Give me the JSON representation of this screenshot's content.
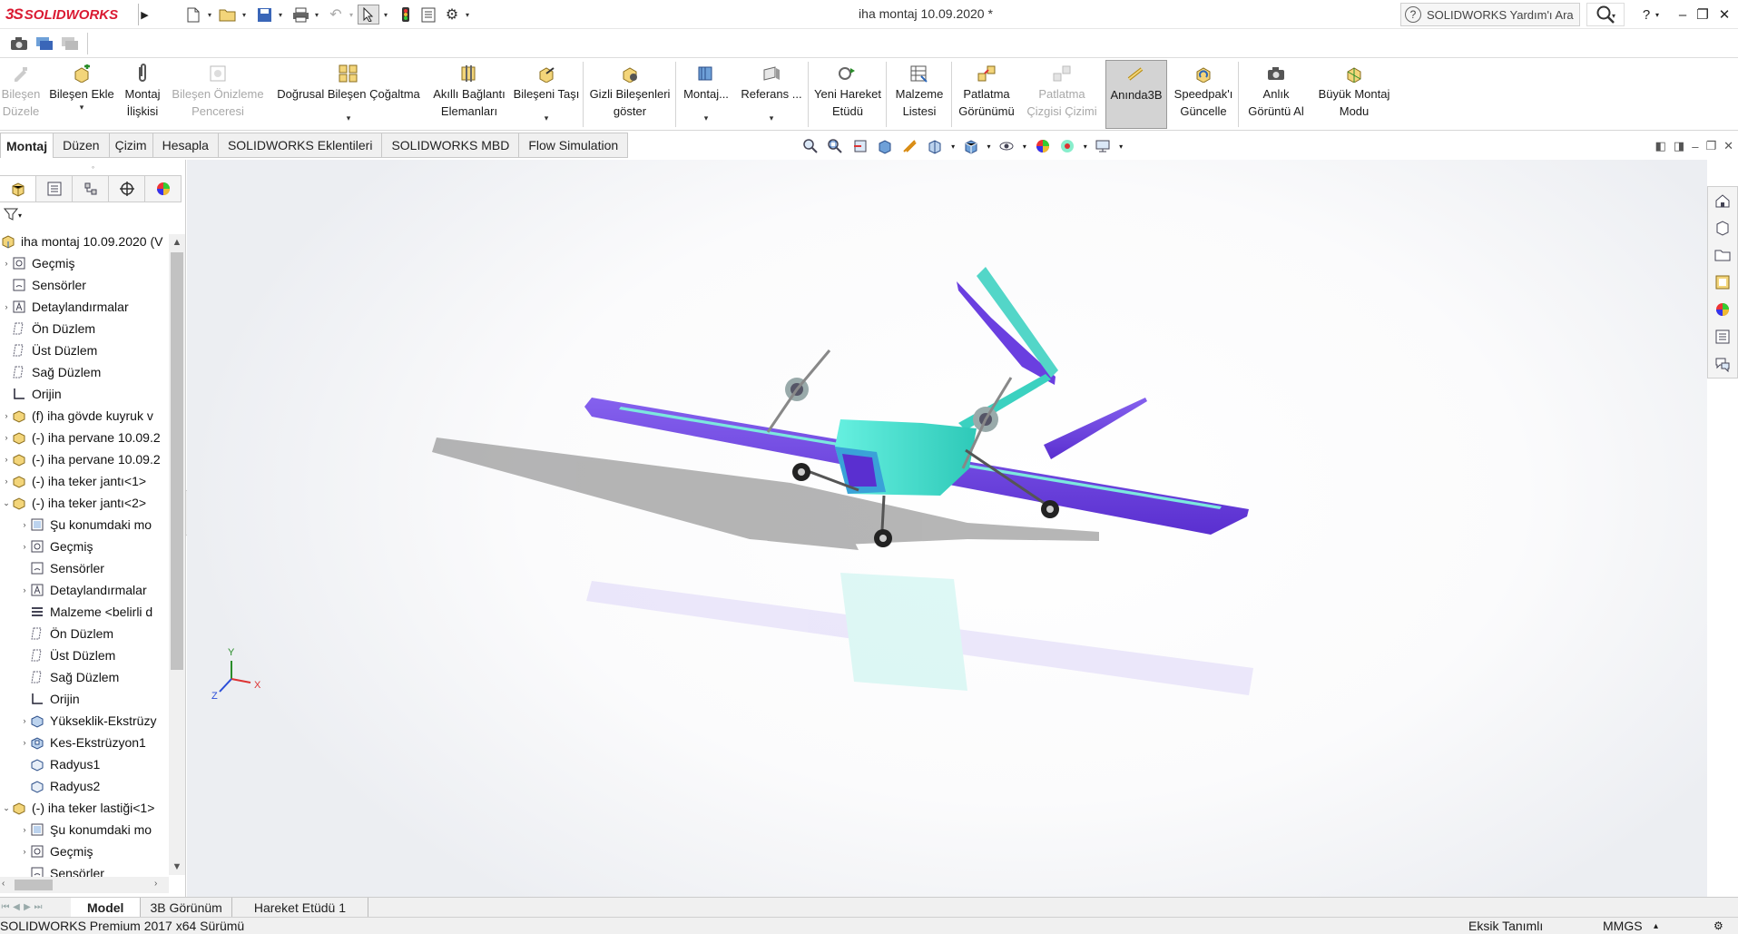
{
  "app": {
    "logo_ds": "3S",
    "logo_name": "SOLIDWORKS",
    "title": "iha montaj 10.09.2020 *"
  },
  "help": {
    "placeholder": "SOLIDWORKS Yardım'ı Ara"
  },
  "commands": [
    {
      "label": "Bileşen Düzele",
      "disabled": true
    },
    {
      "label": "Bileşen Ekle",
      "disabled": false,
      "dropdown": "▾"
    },
    {
      "label": "Montaj İlişkisi",
      "disabled": false
    },
    {
      "label": "Bileşen Önizleme Penceresi",
      "disabled": true
    },
    {
      "label": "Doğrusal Bileşen Çoğaltma",
      "disabled": false,
      "dropdown": "▾"
    },
    {
      "label": "Akıllı Bağlantı Elemanları",
      "disabled": false
    },
    {
      "label": "Bileşeni Taşı",
      "disabled": false,
      "dropdown": "▾"
    },
    {
      "label": "Gizli Bileşenleri göster",
      "disabled": false
    },
    {
      "label": "Montaj...",
      "disabled": false,
      "dropdown": "▾"
    },
    {
      "label": "Referans ...",
      "disabled": false,
      "dropdown": "▾"
    },
    {
      "label": "Yeni Hareket Etüdü",
      "disabled": false
    },
    {
      "label": "Malzeme Listesi",
      "disabled": false
    },
    {
      "label": "Patlatma Görünümü",
      "disabled": false
    },
    {
      "label": "Patlatma Çizgisi Çizimi",
      "disabled": true
    },
    {
      "label": "Anında3B",
      "disabled": false,
      "active": true
    },
    {
      "label": "Speedpak'ı Güncelle",
      "disabled": false
    },
    {
      "label": "Anlık Görüntü Al",
      "disabled": false
    },
    {
      "label": "Büyük Montaj Modu",
      "disabled": false
    }
  ],
  "tabs": [
    "Montaj",
    "Düzen",
    "Çizim",
    "Hesapla",
    "SOLIDWORKS Eklentileri",
    "SOLIDWORKS MBD",
    "Flow Simulation"
  ],
  "tree": [
    {
      "label": "iha montaj 10.09.2020  (V",
      "level": 0,
      "tw": "",
      "icon": "assembly-icon"
    },
    {
      "label": "Geçmiş",
      "level": 1,
      "tw": "›",
      "icon": "history-icon"
    },
    {
      "label": "Sensörler",
      "level": 1,
      "tw": "",
      "icon": "sensor-icon"
    },
    {
      "label": "Detaylandırmalar",
      "level": 1,
      "tw": "›",
      "icon": "annotation-icon"
    },
    {
      "label": "Ön Düzlem",
      "level": 1,
      "tw": "",
      "icon": "plane-icon"
    },
    {
      "label": "Üst Düzlem",
      "level": 1,
      "tw": "",
      "icon": "plane-icon"
    },
    {
      "label": "Sağ Düzlem",
      "level": 1,
      "tw": "",
      "icon": "plane-icon"
    },
    {
      "label": "Orijin",
      "level": 1,
      "tw": "",
      "icon": "origin-icon"
    },
    {
      "label": "(f) iha gövde kuyruk v",
      "level": 1,
      "tw": "›",
      "icon": "part-icon"
    },
    {
      "label": "(-) iha pervane 10.09.2",
      "level": 1,
      "tw": "›",
      "icon": "part-icon"
    },
    {
      "label": "(-) iha pervane 10.09.2",
      "level": 1,
      "tw": "›",
      "icon": "part-icon"
    },
    {
      "label": "(-) iha teker jantı<1>",
      "level": 1,
      "tw": "›",
      "icon": "part-icon"
    },
    {
      "label": "(-) iha teker jantı<2>",
      "level": 1,
      "tw": "⌄",
      "icon": "part-icon"
    },
    {
      "label": "Şu konumdaki mo",
      "level": 2,
      "tw": "›",
      "icon": "folder-icon"
    },
    {
      "label": "Geçmiş",
      "level": 2,
      "tw": "›",
      "icon": "history-icon"
    },
    {
      "label": "Sensörler",
      "level": 2,
      "tw": "",
      "icon": "sensor-icon"
    },
    {
      "label": "Detaylandırmalar",
      "level": 2,
      "tw": "›",
      "icon": "annotation-icon"
    },
    {
      "label": "Malzeme <belirli d",
      "level": 2,
      "tw": "",
      "icon": "material-icon"
    },
    {
      "label": "Ön Düzlem",
      "level": 2,
      "tw": "",
      "icon": "plane-icon"
    },
    {
      "label": "Üst Düzlem",
      "level": 2,
      "tw": "",
      "icon": "plane-icon"
    },
    {
      "label": "Sağ Düzlem",
      "level": 2,
      "tw": "",
      "icon": "plane-icon"
    },
    {
      "label": "Orijin",
      "level": 2,
      "tw": "",
      "icon": "origin-icon"
    },
    {
      "label": "Yükseklik-Ekstrüzy",
      "level": 2,
      "tw": "›",
      "icon": "extrude-icon"
    },
    {
      "label": "Kes-Ekstrüzyon1",
      "level": 2,
      "tw": "›",
      "icon": "cut-extrude-icon"
    },
    {
      "label": "Radyus1",
      "level": 2,
      "tw": "",
      "icon": "fillet-icon"
    },
    {
      "label": "Radyus2",
      "level": 2,
      "tw": "",
      "icon": "fillet-icon"
    },
    {
      "label": "(-) iha teker lastiği<1>",
      "level": 1,
      "tw": "⌄",
      "icon": "part-icon"
    },
    {
      "label": "Şu konumdaki mo",
      "level": 2,
      "tw": "›",
      "icon": "folder-icon"
    },
    {
      "label": "Geçmiş",
      "level": 2,
      "tw": "›",
      "icon": "history-icon"
    },
    {
      "label": "Sensörler",
      "level": 2,
      "tw": "",
      "icon": "sensor-icon"
    }
  ],
  "triad": {
    "x": "X",
    "y": "Y",
    "z": "Z"
  },
  "bottom_tabs": [
    "Model",
    "3B Görünüm",
    "Hareket Etüdü 1"
  ],
  "status": {
    "version": "SOLIDWORKS Premium 2017 x64 Sürümü",
    "definition": "Eksik Tanımlı",
    "units": "MMGS",
    "units_arrow": "▴"
  },
  "colors": {
    "wing": "#6a3fe0",
    "body": "#40e0cf",
    "accent": "#da1a32"
  }
}
